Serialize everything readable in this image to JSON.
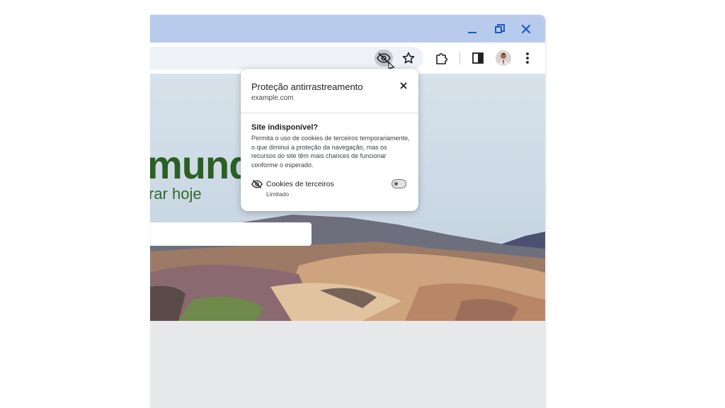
{
  "window": {
    "controls": {
      "minimize": "minimize-icon",
      "restore": "restore-icon",
      "close": "close-icon"
    },
    "colors": {
      "titlebar": "#b9cbec",
      "accent_icon": "#1a5cc8"
    }
  },
  "toolbar": {
    "icons": [
      "tracking-protection-eye-off-icon",
      "bookmark-star-icon",
      "extensions-puzzle-icon",
      "side-panel-icon",
      "profile-avatar",
      "more-menu-icon"
    ]
  },
  "page": {
    "headline": "mund",
    "subline": "rar hoje",
    "colors": {
      "headline": "#2b5f24"
    }
  },
  "popup": {
    "title": "Proteção antirrastreamento",
    "site": "example.com",
    "heading": "Site indisponível?",
    "body": "Permita o uso de cookies de terceiros temporariamente, o que diminui a proteção da navegação, mas os recursos do site têm mais chances de funcionar conforme o esperado.",
    "setting": {
      "label": "Cookies de terceiros",
      "status": "Limitado",
      "enabled": false
    }
  }
}
